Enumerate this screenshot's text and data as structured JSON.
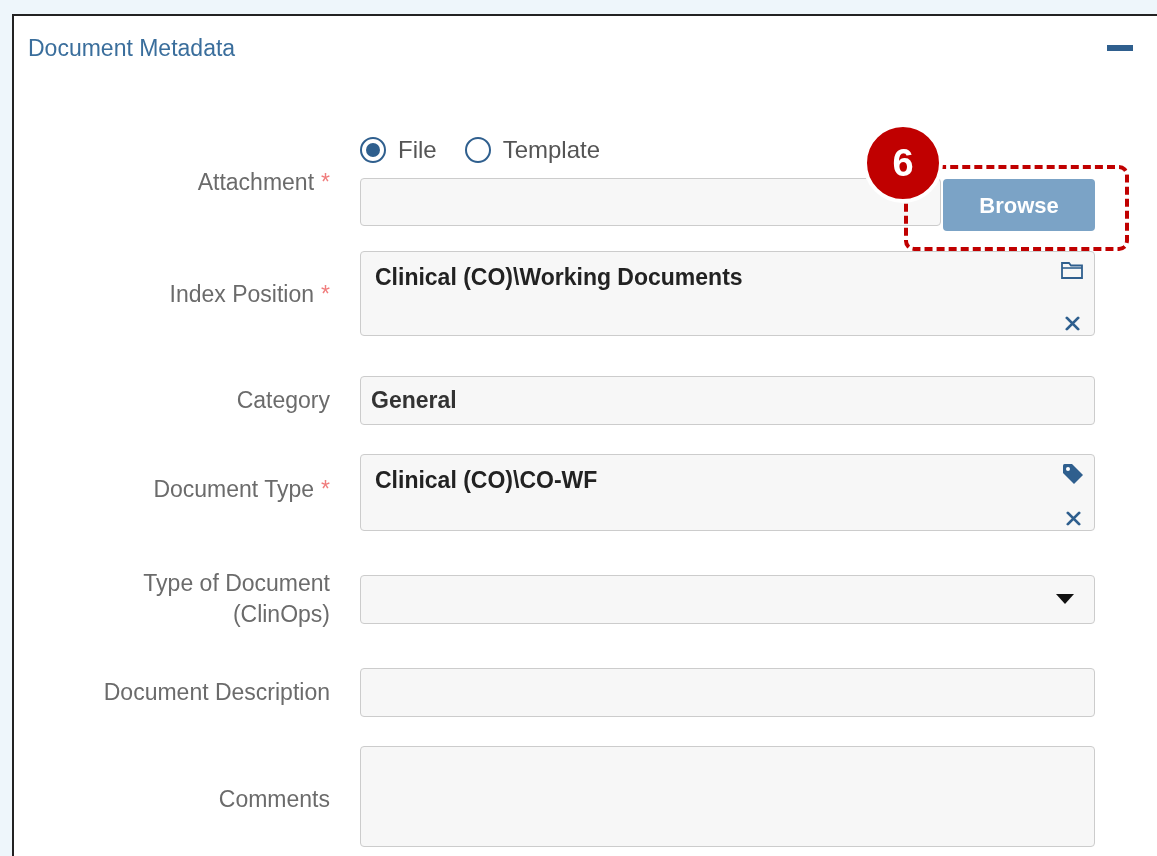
{
  "panel": {
    "title": "Document Metadata"
  },
  "attachment": {
    "label": "Attachment",
    "required_mark": "*",
    "options": [
      {
        "label": "File",
        "selected": true
      },
      {
        "label": "Template",
        "selected": false
      }
    ],
    "browse_button": "Browse"
  },
  "fields": [
    {
      "kind": "folder",
      "label": "Index Position",
      "required_mark": "*",
      "value": "Clinical (CO)\\Working Documents"
    },
    {
      "kind": "text",
      "label": "Category",
      "value": "General"
    },
    {
      "kind": "tag",
      "label": "Document Type",
      "required_mark": "*",
      "value": "Clinical (CO)\\CO-WF"
    },
    {
      "kind": "select",
      "label": "Type of Document (ClinOps)"
    },
    {
      "kind": "text",
      "label": "Document Description"
    },
    {
      "kind": "textarea",
      "label": "Comments"
    }
  ],
  "callout": {
    "number": "6"
  }
}
